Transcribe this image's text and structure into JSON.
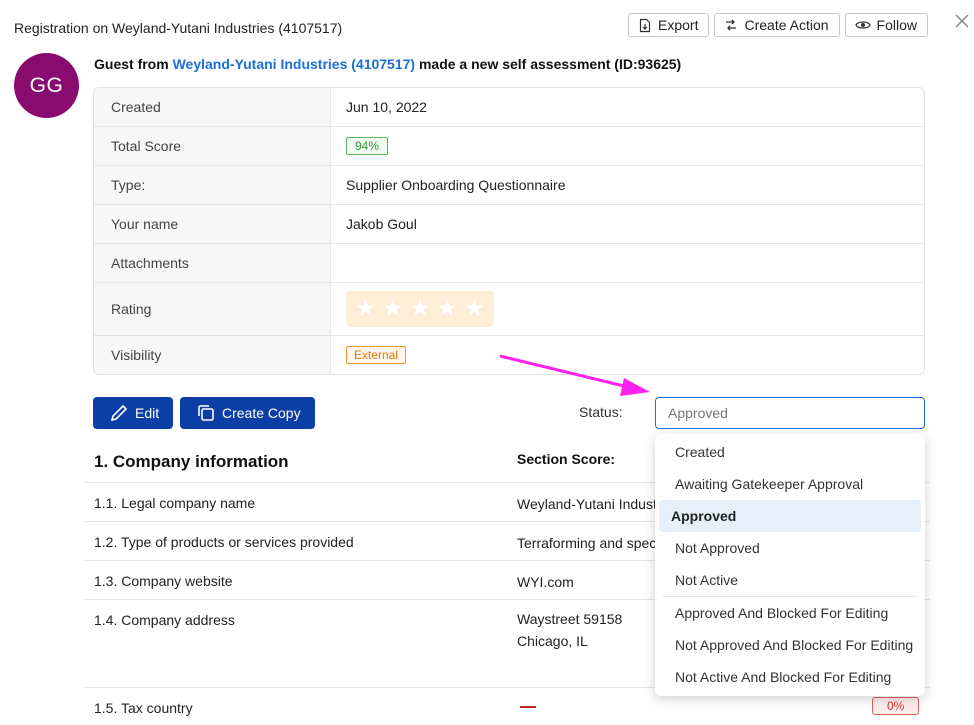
{
  "title": "Registration on Weyland-Yutani Industries (4107517)",
  "top_actions": {
    "export": "Export",
    "create_action": "Create Action",
    "follow": "Follow"
  },
  "avatar_initials": "GG",
  "headline": {
    "prefix": "Guest from ",
    "link": "Weyland-Yutani Industries (4107517)",
    "suffix": " made a new self assessment (ID:93625)"
  },
  "info": {
    "created_label": "Created",
    "created_value": "Jun 10, 2022",
    "score_label": "Total Score",
    "score_value": "94%",
    "type_label": "Type:",
    "type_value": "Supplier Onboarding Questionnaire",
    "name_label": "Your name",
    "name_value": "Jakob Goul",
    "attachments_label": "Attachments",
    "rating_label": "Rating",
    "rating_value": 0,
    "rating_max": 5,
    "visibility_label": "Visibility",
    "visibility_value": "External"
  },
  "actions": {
    "edit": "Edit",
    "create_copy": "Create Copy"
  },
  "status": {
    "label": "Status:",
    "value": "Approved",
    "options": [
      "Created",
      "Awaiting Gatekeeper Approval",
      "Approved",
      "Not Approved",
      "Not Active",
      "Approved And Blocked For Editing",
      "Not Approved And Blocked For Editing",
      "Not Active And Blocked For Editing"
    ]
  },
  "section": {
    "title": "1. Company information",
    "score_label": "Section Score:",
    "rows": [
      {
        "q": "1.1. Legal company name",
        "a": "Weyland-Yutani Indust"
      },
      {
        "q": "1.2. Type of products or services provided",
        "a": "Terraforming and spec"
      },
      {
        "q": "1.3. Company website",
        "a": "WYI.com"
      },
      {
        "q": "1.4. Company address",
        "a1": "Waystreet 59158",
        "a2": "Chicago, IL"
      },
      {
        "q": "1.5. Tax country",
        "score": "0%"
      }
    ]
  },
  "colors": {
    "accent": "#0b3fa6",
    "avatar": "#8a0b6f",
    "link": "#1a6fd6",
    "annotation_arrow": "#ff22ee"
  }
}
